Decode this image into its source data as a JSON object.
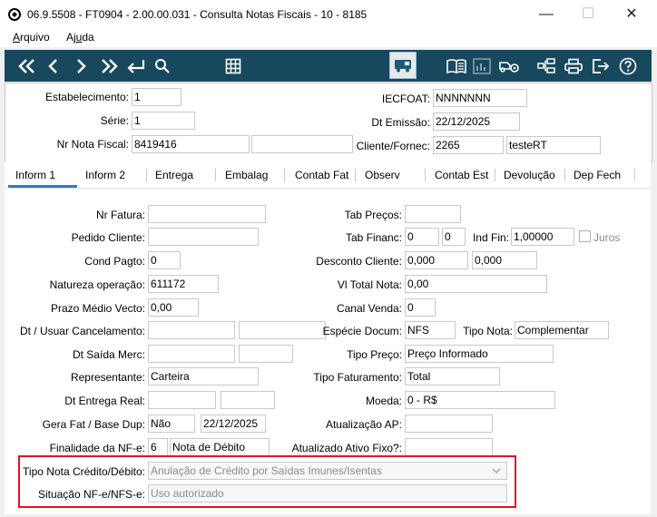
{
  "window": {
    "title": "06.9.5508 - FT0904 - 2.00.00.031 - Consulta Notas Fiscais - 10 - 8185",
    "minimize": "—",
    "maximize": "☐",
    "close": "✕"
  },
  "menu": {
    "arquivo_pre": "",
    "arquivo_ul": "A",
    "arquivo_post": "rquivo",
    "ajuda_pre": "Aj",
    "ajuda_ul": "u",
    "ajuda_post": "da"
  },
  "toolbar": {
    "accent": "#17485d",
    "icons": [
      "first-icon",
      "prev-icon",
      "next-icon",
      "last-icon",
      "goto-icon",
      "search-icon",
      "grid-icon",
      "truck-icon",
      "book-icon",
      "chart-icon",
      "vehicle-config-icon",
      "tree-icon",
      "print-icon",
      "exit-icon",
      "help-icon"
    ]
  },
  "header": {
    "estabelecimento_label": "Estabelecimento:",
    "estabelecimento_value": "1",
    "serie_label": "Série:",
    "serie_value": "1",
    "nr_nota_label": "Nr Nota Fiscal:",
    "nr_nota_value": "8419416",
    "nr_nota_extra": "",
    "iecfoat_label": "IECFOAT:",
    "iecfoat_value": "NNNNNNN",
    "dt_emissao_label": "Dt Emissão:",
    "dt_emissao_value": "22/12/2025",
    "cliente_label": "Cliente/Fornec:",
    "cliente_code": "2265",
    "cliente_name": "testeRT"
  },
  "tabs": [
    "Inform 1",
    "Inform 2",
    "Entrega",
    "Embalag",
    "Contab Fat",
    "Observ",
    "Contab Est",
    "Devolução",
    "Dep Fech"
  ],
  "form": {
    "nr_fatura_label": "Nr Fatura:",
    "nr_fatura_value": "",
    "pedido_cliente_label": "Pedido Cliente:",
    "pedido_cliente_value": "",
    "cond_pagto_label": "Cond Pagto:",
    "cond_pagto_value": "0",
    "natureza_label": "Natureza operação:",
    "natureza_value": "611172",
    "prazo_label": "Prazo Médio Vecto:",
    "prazo_value": "0,00",
    "dt_cancel_label": "Dt / Usuar Cancelamento:",
    "dt_cancel_value1": "",
    "dt_cancel_value2": "",
    "dt_saida_label": "Dt Saída Merc:",
    "dt_saida_value1": "",
    "dt_saida_value2": "",
    "representante_label": "Representante:",
    "representante_value": "Carteira",
    "dt_entrega_label": "Dt Entrega Real:",
    "dt_entrega_value1": "",
    "dt_entrega_value2": "",
    "gera_fat_label": "Gera Fat / Base Dup:",
    "gera_fat_value": "Não",
    "base_dup_value": "22/12/2025",
    "finalidade_label": "Finalidade da NF-e:",
    "finalidade_code": "6",
    "finalidade_desc": "Nota de Débito",
    "tab_precos_label": "Tab Preços:",
    "tab_precos_value": "",
    "tab_financ_label": "Tab Financ:",
    "tab_financ_value1": "0",
    "tab_financ_value2": "0",
    "ind_fin_label": "Ind Fin:",
    "ind_fin_value": "1,00000",
    "juros_label": "Juros",
    "desconto_label": "Desconto Cliente:",
    "desconto_value1": "0,000",
    "desconto_value2": "0,000",
    "vl_total_label": "Vl Total Nota:",
    "vl_total_value": "0,00",
    "canal_label": "Canal Venda:",
    "canal_value": "0",
    "especie_label": "Espécie Docum:",
    "especie_value": "NFS",
    "tipo_nota_label": "Tipo Nota:",
    "tipo_nota_value": "Complementar",
    "tipo_preco_label": "Tipo Preço:",
    "tipo_preco_value": "Preço Informado",
    "tipo_fat_label": "Tipo Faturamento:",
    "tipo_fat_value": "Total",
    "moeda_label": "Moeda:",
    "moeda_value": "0 - R$",
    "atual_ap_label": "Atualização AP:",
    "atual_ap_value": "",
    "atual_ativo_label": "Atualizado Ativo Fixo?:",
    "atual_ativo_value": "",
    "tipo_credito_label": "Tipo Nota Crédito/Débito:",
    "tipo_credito_value": "Anulação de Crédito por Saídas Imunes/Isentas",
    "situacao_label": "Situação NF-e/NFS-e:",
    "situacao_value": "Uso autorizado"
  }
}
